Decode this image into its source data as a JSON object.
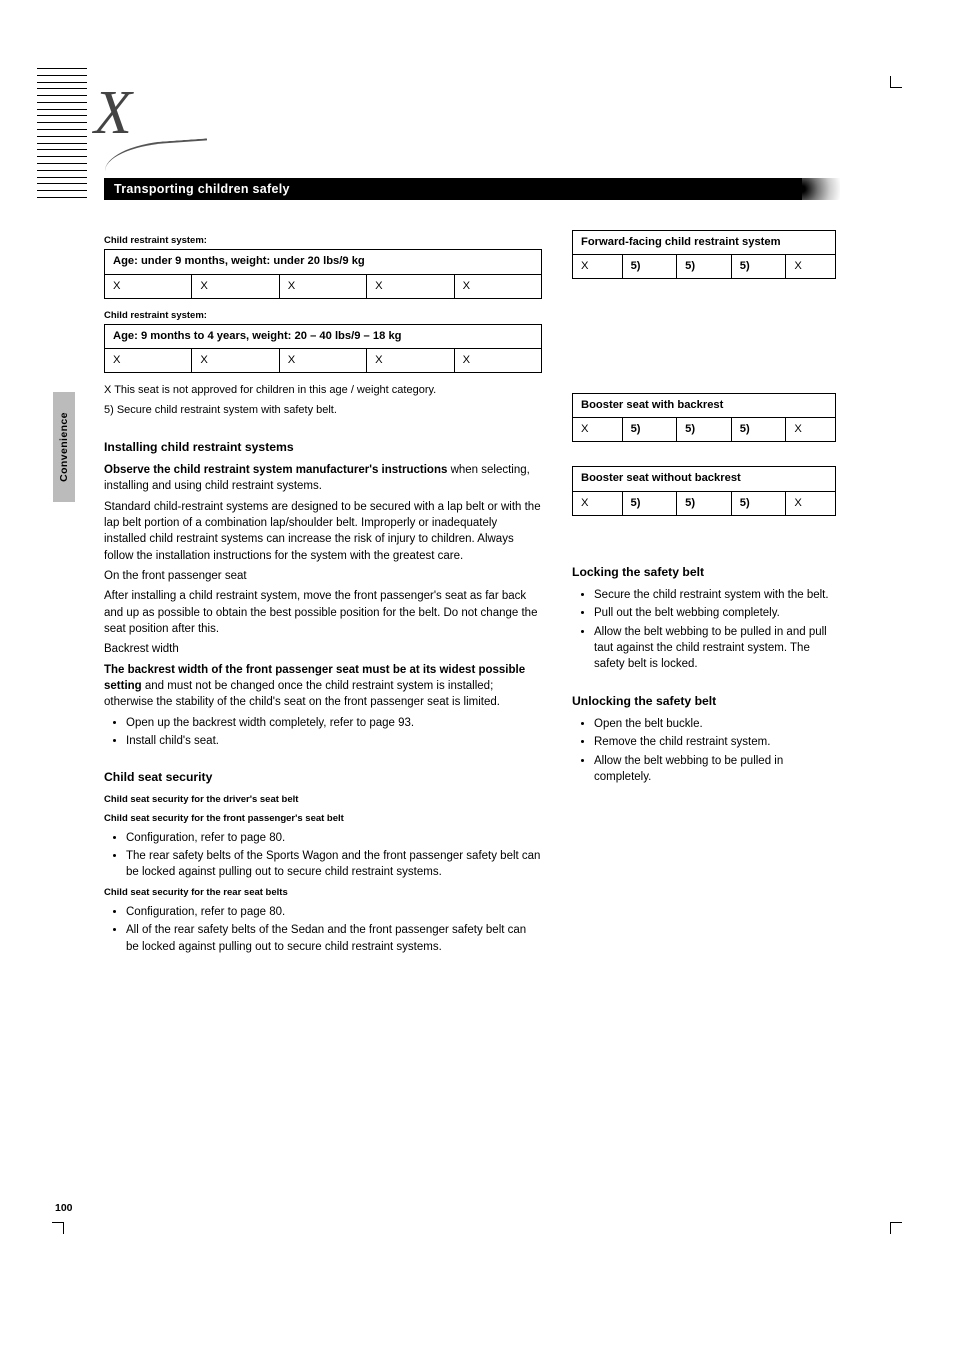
{
  "page_number": "100",
  "side_tab": "Convenience",
  "section_title": "Transporting children safely",
  "table_a": {
    "label": "Child restraint system:",
    "head": "Age: under 9 months, weight: under 20 lbs/9 kg",
    "cells": [
      "X",
      "X",
      "X",
      "X",
      "X"
    ]
  },
  "table_b": {
    "label": "Child restraint system:",
    "head": "Age: 9 months to 4 years, weight: 20 – 40 lbs/9 – 18 kg",
    "cells": [
      "X",
      "X",
      "X",
      "X",
      "X"
    ]
  },
  "table_c": {
    "head": "Forward-facing child restraint system",
    "cells": [
      "X",
      "5)",
      "5)",
      "5)",
      "X"
    ]
  },
  "table_d": {
    "head": "Booster seat with backrest",
    "cells": [
      "X",
      "5)",
      "5)",
      "5)",
      "X"
    ]
  },
  "table_e": {
    "head": "Booster seat without backrest",
    "cells": [
      "X",
      "5)",
      "5)",
      "5)",
      "X"
    ]
  },
  "legend_x": "X This seat is not approved for children in this age / weight category.",
  "legend_5": "5) Secure child restraint system with safety belt.",
  "sect1": "Installing child restraint systems",
  "para1_lead": "Observe the child restraint system manufacturer's instructions ",
  "para1_rest": "when selecting, installing and using child restraint systems.",
  "para2": "Standard child-restraint systems are designed to be secured with a lap belt or with the lap belt portion of a combination lap/shoulder belt. Improperly or inadequately installed child restraint systems can increase the risk of injury to children. Always follow the installation instructions for the system with the greatest care.",
  "seat_head": "On the front passenger seat",
  "seat_para": "After installing a child restraint system, move the front passenger's seat as far back and up as possible to obtain the best possible position for the belt. Do not change the seat position after this.",
  "back_head": "Backrest width",
  "back_para_lead": "The backrest width of the front passenger seat must be at its widest possible setting ",
  "back_para_rest": "and must not be changed once the child restraint system is installed; otherwise the stability of the child's seat on the front passenger seat is limited.",
  "bw1": "Open up the backrest width completely, refer to page",
  "bw1_ref": "93",
  "bw2": "Install child's seat.",
  "child_head": "Child seat security",
  "cs_label1": "Child seat security for the driver's seat belt",
  "cs_label2": "Child seat security for the front passenger's seat belt",
  "cs1a": "Configuration, refer to page",
  "cs1a_ref": "80",
  "cs1b": "The rear safety belts of the Sports Wagon and the front passenger safety belt can be locked against pulling out to secure child restraint systems.",
  "cs_label3": "Child seat security for the rear seat belts",
  "cs2a": "Configuration, refer to page",
  "cs2a_ref": "80",
  "cs2b": "All of the rear safety belts of the Sedan and the front passenger safety belt can be locked against pulling out to secure child restraint systems.",
  "sect2": "Locking the safety belt",
  "lock_items": [
    "Secure the child restraint system with the belt.",
    "Pull out the belt webbing completely.",
    "Allow the belt webbing to be pulled in and pull taut against the child restraint system. The safety belt is locked."
  ],
  "sect3": "Unlocking the safety belt",
  "unlock_items": [
    "Open the belt buckle.",
    "Remove the child restraint system.",
    "Allow the belt webbing to be pulled in completely."
  ]
}
